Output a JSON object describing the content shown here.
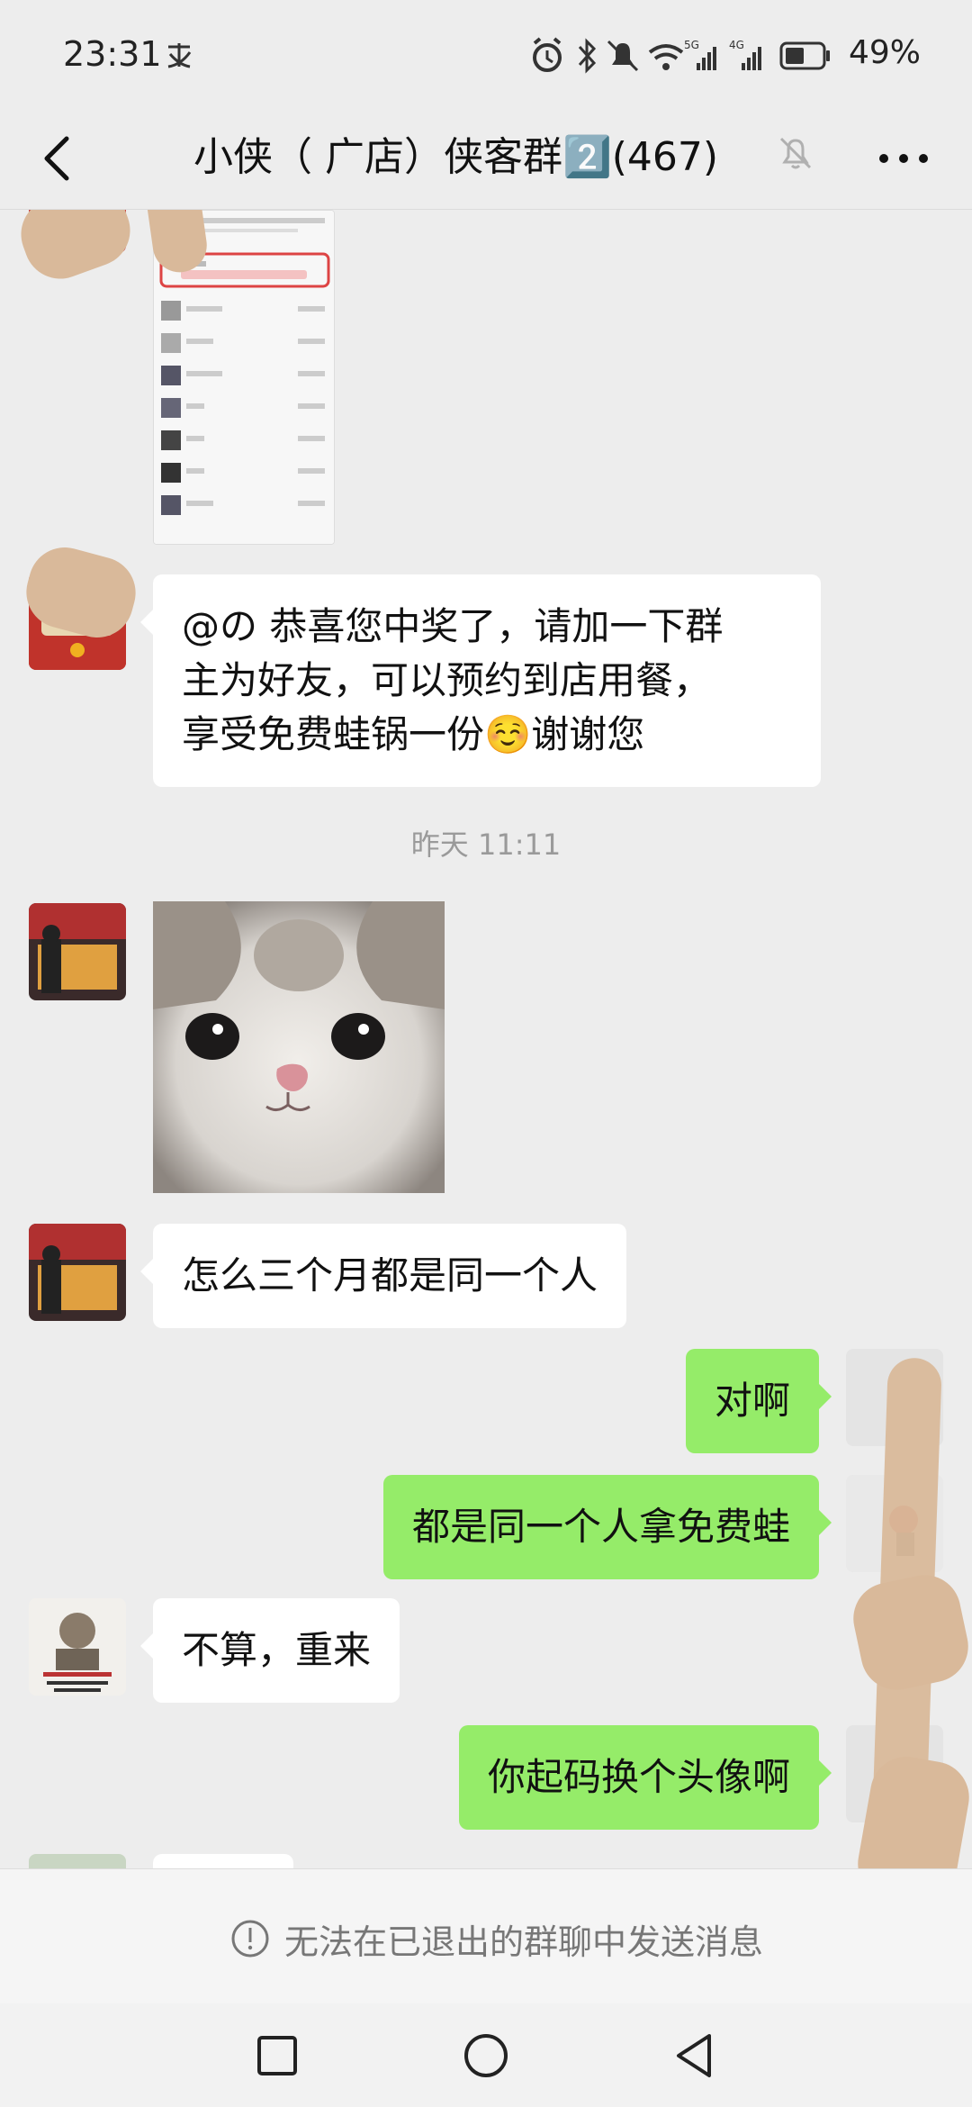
{
  "status_bar": {
    "time": "23:31",
    "battery": "49%",
    "network_5g": "5G",
    "network_4g": "4G"
  },
  "header": {
    "title": "小侠（ 广店）侠客群2️⃣(467)",
    "back_icon": "chevron-left-icon",
    "mute_icon": "bell-off-icon",
    "more_icon": "more-dots-icon"
  },
  "messages": [
    {
      "type": "image",
      "side": "in",
      "description_icon": "screenshot-image"
    },
    {
      "type": "text",
      "side": "in",
      "text": "@の 恭喜您中奖了，请加一下群主为好友，可以预约到店用餐，享受免费蛙锅一份☺️谢谢您",
      "lines": [
        "@の 恭喜您中奖了，请加一下群",
        "主为好友，可以预约到店用餐，",
        "享受免费蛙锅一份☺️谢谢您"
      ]
    },
    {
      "type": "time",
      "text": "昨天 11:11"
    },
    {
      "type": "image",
      "side": "in",
      "description_icon": "cat-sticker-image"
    },
    {
      "type": "text",
      "side": "in",
      "text": "怎么三个月都是同一个人"
    },
    {
      "type": "text",
      "side": "out",
      "text": "对啊"
    },
    {
      "type": "text",
      "side": "out",
      "text": "都是同一个人拿免费蛙"
    },
    {
      "type": "text",
      "side": "in",
      "text": "不算，重来"
    },
    {
      "type": "text",
      "side": "out",
      "text": "你起码换个头像啊"
    }
  ],
  "notice": {
    "text": "无法在已退出的群聊中发送消息",
    "icon": "exclamation-circle-icon"
  },
  "nav": {
    "recent_icon": "square-icon",
    "home_icon": "circle-icon",
    "back_icon": "triangle-back-icon"
  },
  "colors": {
    "background": "#ededed",
    "bubble_in": "#ffffff",
    "bubble_out": "#95ec69"
  }
}
